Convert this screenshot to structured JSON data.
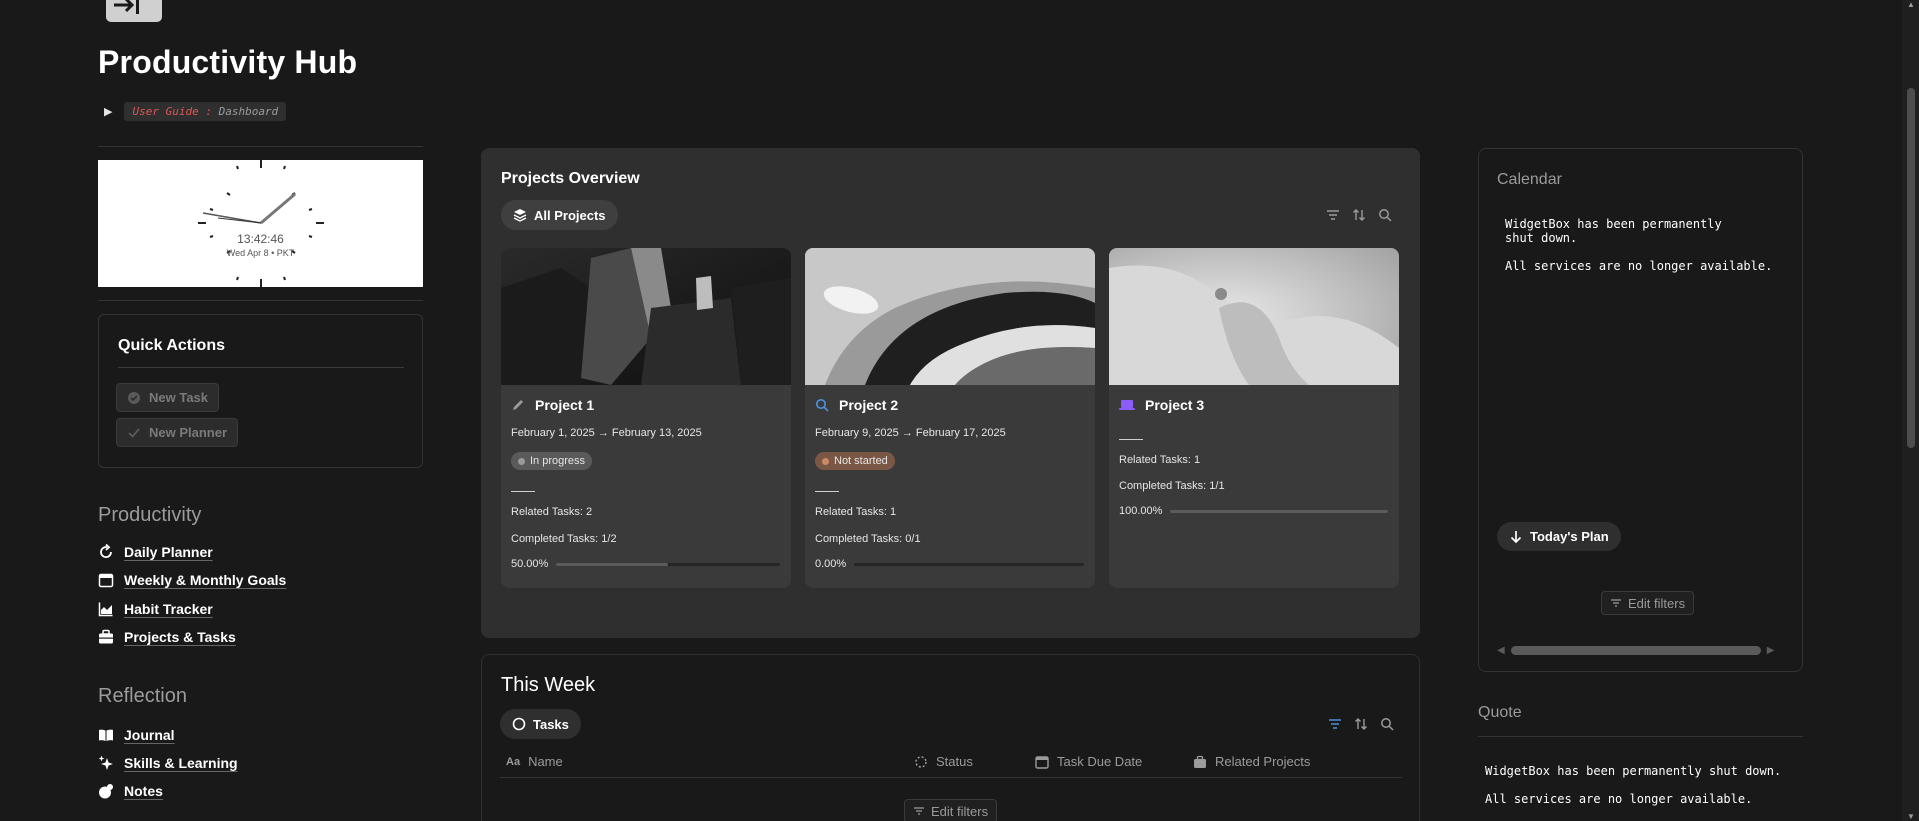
{
  "page": {
    "title": "Productivity Hub",
    "toggle": {
      "label_red": "User Guide :",
      "label_grey": "Dashboard"
    }
  },
  "clock": {
    "time": "13:42:46",
    "date": "Wed Apr 8 • PKT"
  },
  "quick_actions": {
    "title": "Quick Actions",
    "buttons": [
      "New Task",
      "New Planner"
    ]
  },
  "productivity": {
    "heading": "Productivity",
    "items": [
      {
        "label": "Daily Planner",
        "icon": "refresh-icon"
      },
      {
        "label": "Weekly & Monthly Goals",
        "icon": "calendar-icon"
      },
      {
        "label": "Habit Tracker",
        "icon": "chart-icon"
      },
      {
        "label": "Projects & Tasks",
        "icon": "briefcase-icon"
      }
    ]
  },
  "reflection": {
    "heading": "Reflection",
    "items": [
      {
        "label": "Journal",
        "icon": "book-icon"
      },
      {
        "label": "Skills & Learning",
        "icon": "sparkle-icon"
      },
      {
        "label": "Notes",
        "icon": "notes-icon"
      }
    ]
  },
  "projects": {
    "title": "Projects Overview",
    "view_tab": "All Projects",
    "cards": [
      {
        "title": "Project 1",
        "icon": "pencil-icon",
        "dates": "February 1, 2025 → February 13, 2025",
        "status": "In progress",
        "status_color": "#5a5a5a",
        "status_dot": "#9b9b9b",
        "related": "Related Tasks: 2",
        "completed": "Completed Tasks: 1/2",
        "progress_label": "50.00%",
        "progress": 0.5
      },
      {
        "title": "Project 2",
        "icon": "search-icon",
        "dates": "February 9, 2025 → February 17, 2025",
        "status": "Not started",
        "status_color": "#7a5744",
        "status_dot": "#c98b63",
        "related": "Related Tasks: 1",
        "completed": "Completed Tasks: 0/1",
        "progress_label": "0.00%",
        "progress": 0
      },
      {
        "title": "Project 3",
        "icon": "laptop-icon",
        "dates": "",
        "status": "",
        "related": "Related Tasks: 1",
        "completed": "Completed Tasks: 1/1",
        "progress_label": "100.00%",
        "progress": 1
      }
    ]
  },
  "this_week": {
    "title": "This Week",
    "view_tab": "Tasks",
    "columns": [
      "Name",
      "Status",
      "Task Due Date",
      "Related Projects"
    ],
    "edit_filters": "Edit filters"
  },
  "calendar": {
    "title": "Calendar",
    "message_1": "WidgetBox has been permanently shut down.",
    "message_2": "All services are no longer available.",
    "today_button": "Today's Plan",
    "edit_filters": "Edit filters"
  },
  "quote": {
    "title": "Quote",
    "message_1": "WidgetBox has been permanently shut down.",
    "message_2": "All services are no longer available."
  }
}
